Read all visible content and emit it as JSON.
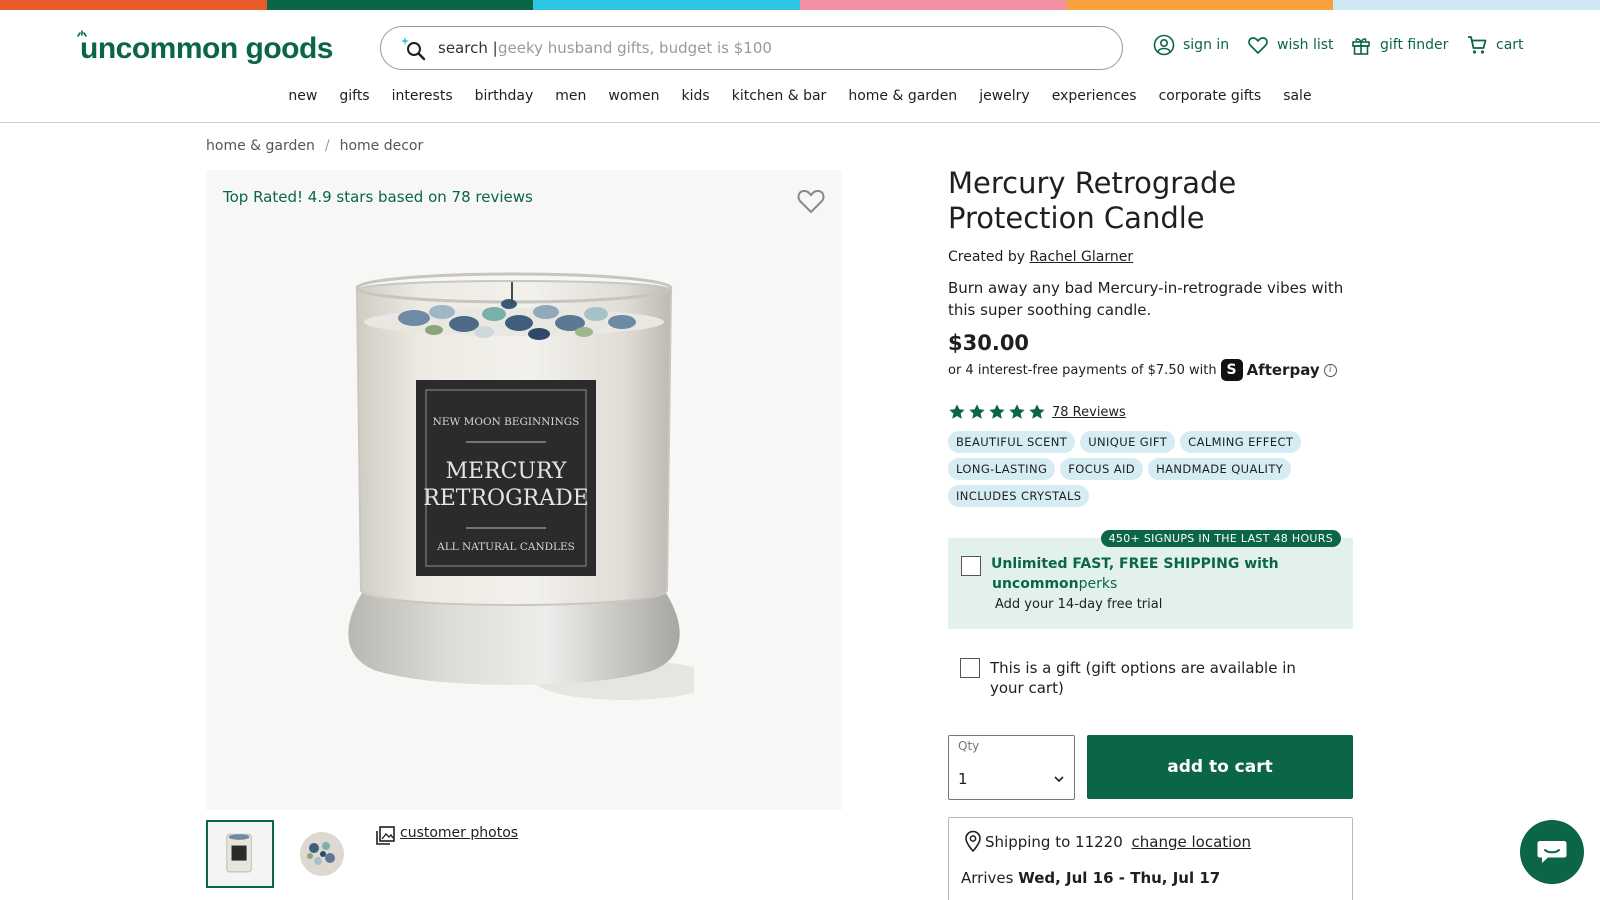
{
  "brand": {
    "logo_text": "uncommon goods",
    "green": "#0b6645",
    "stripe_colors": [
      "#ea5b2a",
      "#0b6645",
      "#2ec4e5",
      "#f28fa1",
      "#f8a23b",
      "#cfe8f1"
    ]
  },
  "search": {
    "label": "search |",
    "placeholder": "geeky husband gifts, budget is $100"
  },
  "utility": {
    "sign_in": "sign in",
    "wish_list": "wish list",
    "gift_finder": "gift finder",
    "cart": "cart"
  },
  "nav": [
    "new",
    "gifts",
    "interests",
    "birthday",
    "men",
    "women",
    "kids",
    "kitchen & bar",
    "home & garden",
    "jewelry",
    "experiences",
    "corporate gifts",
    "sale"
  ],
  "breadcrumb": [
    "home & garden",
    "home decor"
  ],
  "gallery": {
    "top_rated": "Top Rated! 4.9 stars based on 78 reviews",
    "customer_photos": "customer photos",
    "label_top": "NEW MOON BEGINNINGS",
    "label_mid1": "MERCURY",
    "label_mid2": "RETROGRADE",
    "label_bottom": "ALL NATURAL CANDLES"
  },
  "product": {
    "title": "Mercury Retrograde Protection Candle",
    "created_by_prefix": "Created by",
    "creator": "Rachel Glarner",
    "description": "Burn away any bad Mercury-in-retrograde vibes with this super soothing candle.",
    "price": "$30.00",
    "afterpay_text": "or 4 interest-free payments of $7.50 with",
    "afterpay_name": "Afterpay",
    "rating_stars": 5,
    "reviews_link": "78 Reviews",
    "tags": [
      "BEAUTIFUL SCENT",
      "UNIQUE GIFT",
      "CALMING EFFECT",
      "LONG-LASTING",
      "FOCUS AID",
      "HANDMADE QUALITY",
      "INCLUDES CRYSTALS"
    ]
  },
  "perks": {
    "badge": "450+ SIGNUPS IN THE LAST 48 HOURS",
    "line1": "Unlimited FAST, FREE SHIPPING with",
    "brand_bold": "uncommon",
    "brand_light": "perks",
    "line3": "Add your 14-day free trial"
  },
  "gift_option": "This is a gift (gift options are available in your cart)",
  "purchase": {
    "qty_label": "Qty",
    "qty_value": "1",
    "add_to_cart": "add to cart"
  },
  "shipping": {
    "prefix": "Shipping to 11220",
    "change": "change location",
    "arrives_prefix": "Arrives",
    "arrives_dates": "Wed, Jul 16 - Thu, Jul 17"
  }
}
